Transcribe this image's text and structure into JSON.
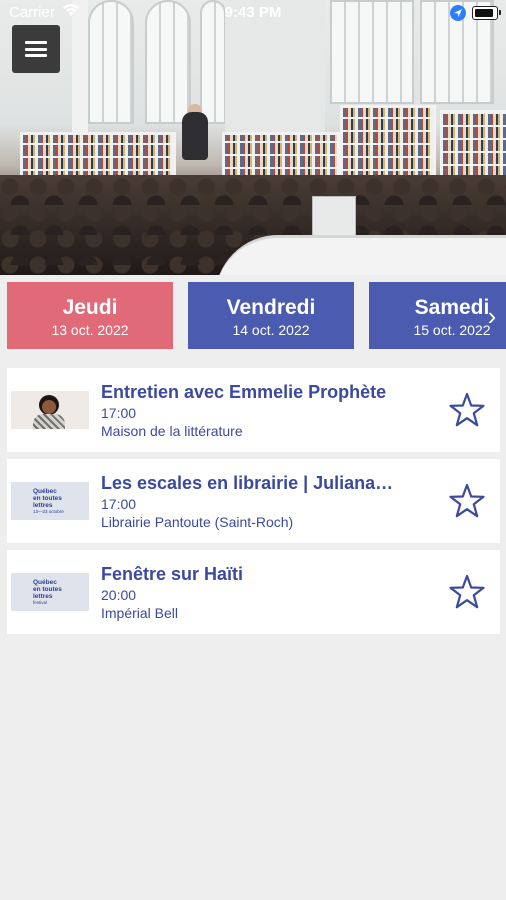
{
  "status_bar": {
    "carrier": "Carrier",
    "time": "9:43 PM"
  },
  "menu": {
    "icon": "hamburger-menu-icon"
  },
  "hero": {
    "description_icon": "event-photo"
  },
  "day_tabs": [
    {
      "day": "Jeudi",
      "date": "13 oct. 2022",
      "color": "#e06a78"
    },
    {
      "day": "Vendredi",
      "date": "14 oct. 2022",
      "color": "#4a5bb0"
    },
    {
      "day": "Samedi",
      "date": "15 oct. 2022",
      "color": "#4a5bb0"
    }
  ],
  "scroll_arrow": "›",
  "events": [
    {
      "title": "Entretien avec Emmelie Prophète",
      "time": "17:00",
      "venue": "Maison de la littérature",
      "thumb": "portrait"
    },
    {
      "title": "Les escales en librairie | Juliana…",
      "time": "17:00",
      "venue": "Librairie Pantoute (Saint-Roch)",
      "thumb": "logo"
    },
    {
      "title": "Fenêtre sur Haïti",
      "time": "20:00",
      "venue": "Impérial Bell",
      "thumb": "logo"
    }
  ],
  "thumb_logo": {
    "line1": "Québec",
    "line2": "en toutes",
    "line3": "lettres",
    "sub1": "13—23 octobre",
    "sub2": "festival"
  },
  "colors": {
    "accent_blue": "#3b4a9e",
    "tab_active": "#e06a78",
    "tab_inactive": "#4a5bb0",
    "background": "#eeeeee"
  }
}
